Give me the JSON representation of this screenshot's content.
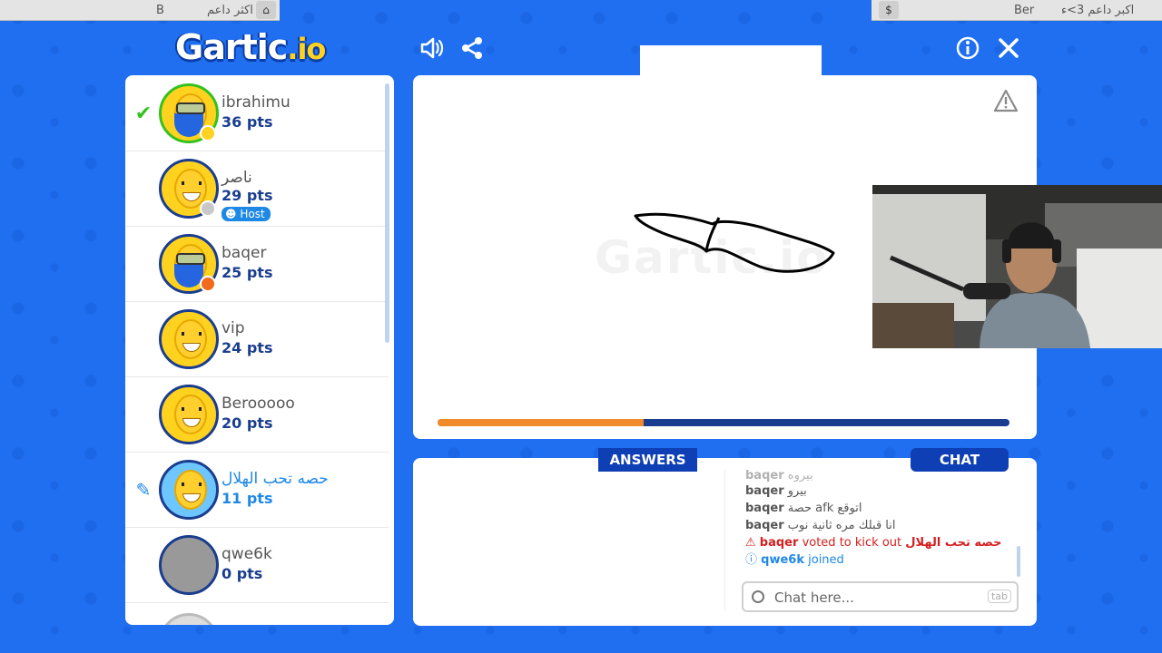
{
  "top_strip": {
    "left_title": "اكثر داعم",
    "left_letter": "B",
    "right_name": "Ber",
    "right_title": "اكبر داعم 3>ء"
  },
  "header": {
    "logo_main": "Gartic",
    "logo_suffix": ".io"
  },
  "players": [
    {
      "name": "ibrahimu",
      "pts": "36 pts",
      "status": "guessed",
      "dot": "#ffd21f"
    },
    {
      "name": "ناصر",
      "pts": "29 pts",
      "badge": "Host",
      "dot": "#c8c8c8"
    },
    {
      "name": "baqer",
      "pts": "25 pts",
      "dot": "#f26a1b"
    },
    {
      "name": "vip",
      "pts": "24 pts"
    },
    {
      "name": "Berooooo",
      "pts": "20 pts"
    },
    {
      "name": "حصه تحب الهلال",
      "pts": "11 pts",
      "status": "drawing"
    },
    {
      "name": "qwe6k",
      "pts": "0 pts"
    }
  ],
  "canvas": {
    "watermark": "Gartic.io",
    "timer_progress": 0.36,
    "timer_color": "#f08a2a"
  },
  "tabs": {
    "answers": "ANSWERS",
    "chat": "CHAT"
  },
  "chat": {
    "messages": [
      {
        "user": "baqer",
        "text": "بيروه"
      },
      {
        "user": "baqer",
        "text": "بيرو"
      },
      {
        "user": "baqer",
        "text": "حصة afk اتوقع"
      },
      {
        "user": "baqer",
        "text": "انا قبلك مره ثانية نوب"
      }
    ],
    "system_kick": {
      "user": "baqer",
      "action": "voted to kick out",
      "target": "حصه تحب الهلال"
    },
    "system_join": {
      "user": "qwe6k",
      "action": "joined"
    },
    "input_placeholder": "Chat here...",
    "tab_hint": "tab"
  }
}
